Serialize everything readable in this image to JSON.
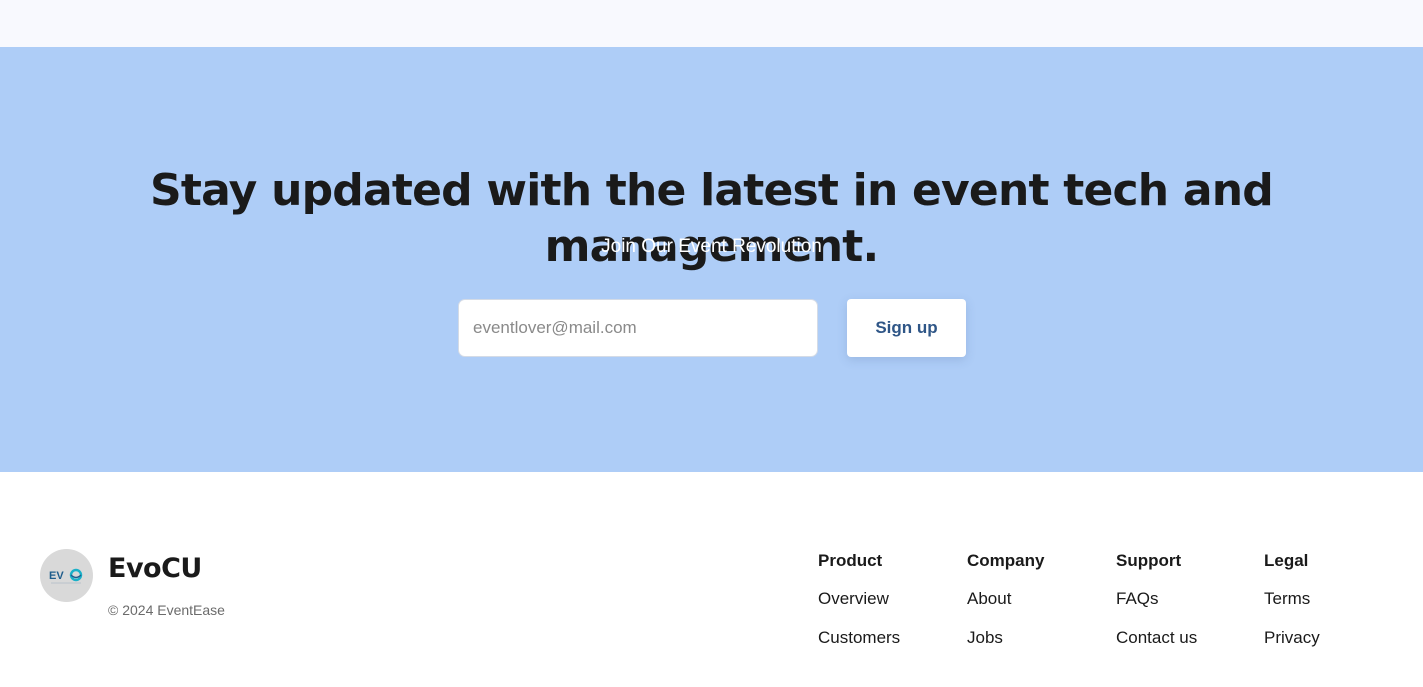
{
  "newsletter": {
    "headline": "Stay updated with the latest in event tech and management.",
    "subheadline": "Join Our Event Revolution",
    "email_placeholder": "eventlover@mail.com",
    "signup_label": "Sign up",
    "background_color": "#aecdf7"
  },
  "footer": {
    "brand_name": "EvoCU",
    "logo_text": "EVO",
    "copyright": "© 2024 EventEase",
    "columns": [
      {
        "heading": "Product",
        "links": [
          "Overview",
          "Customers"
        ]
      },
      {
        "heading": "Company",
        "links": [
          "About",
          "Jobs"
        ]
      },
      {
        "heading": "Support",
        "links": [
          "FAQs",
          "Contact us"
        ]
      },
      {
        "heading": "Legal",
        "links": [
          "Terms",
          "Privacy"
        ]
      }
    ]
  }
}
